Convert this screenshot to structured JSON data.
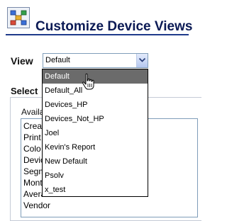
{
  "header": {
    "title": "Customize Device Views",
    "icon": "device-views-icon"
  },
  "view": {
    "label": "View",
    "value": "Default",
    "arrow_icon": "chevron-down-icon"
  },
  "dropdown": {
    "options": [
      {
        "label": "Default",
        "selected": true
      },
      {
        "label": "Default_All",
        "selected": false
      },
      {
        "label": "Devices_HP",
        "selected": false
      },
      {
        "label": "Devices_Not_HP",
        "selected": false
      },
      {
        "label": "Joel",
        "selected": false
      },
      {
        "label": "Kevin's Report",
        "selected": false
      },
      {
        "label": "New Default",
        "selected": false
      },
      {
        "label": "Psolv",
        "selected": false
      },
      {
        "label": "x_test",
        "selected": false
      }
    ],
    "selected_bg": "#6b6b6b",
    "cursor_icon": "hand-pointer-icon"
  },
  "select_section": {
    "heading": "Select",
    "available_label": "Availa",
    "available_items": [
      "Crea",
      "Print",
      "Colo",
      "Devic",
      "Segm",
      "Mont",
      "Avera",
      "Vendor"
    ]
  },
  "colors": {
    "title": "#0b1a55",
    "rule": "#1e3a8a"
  }
}
